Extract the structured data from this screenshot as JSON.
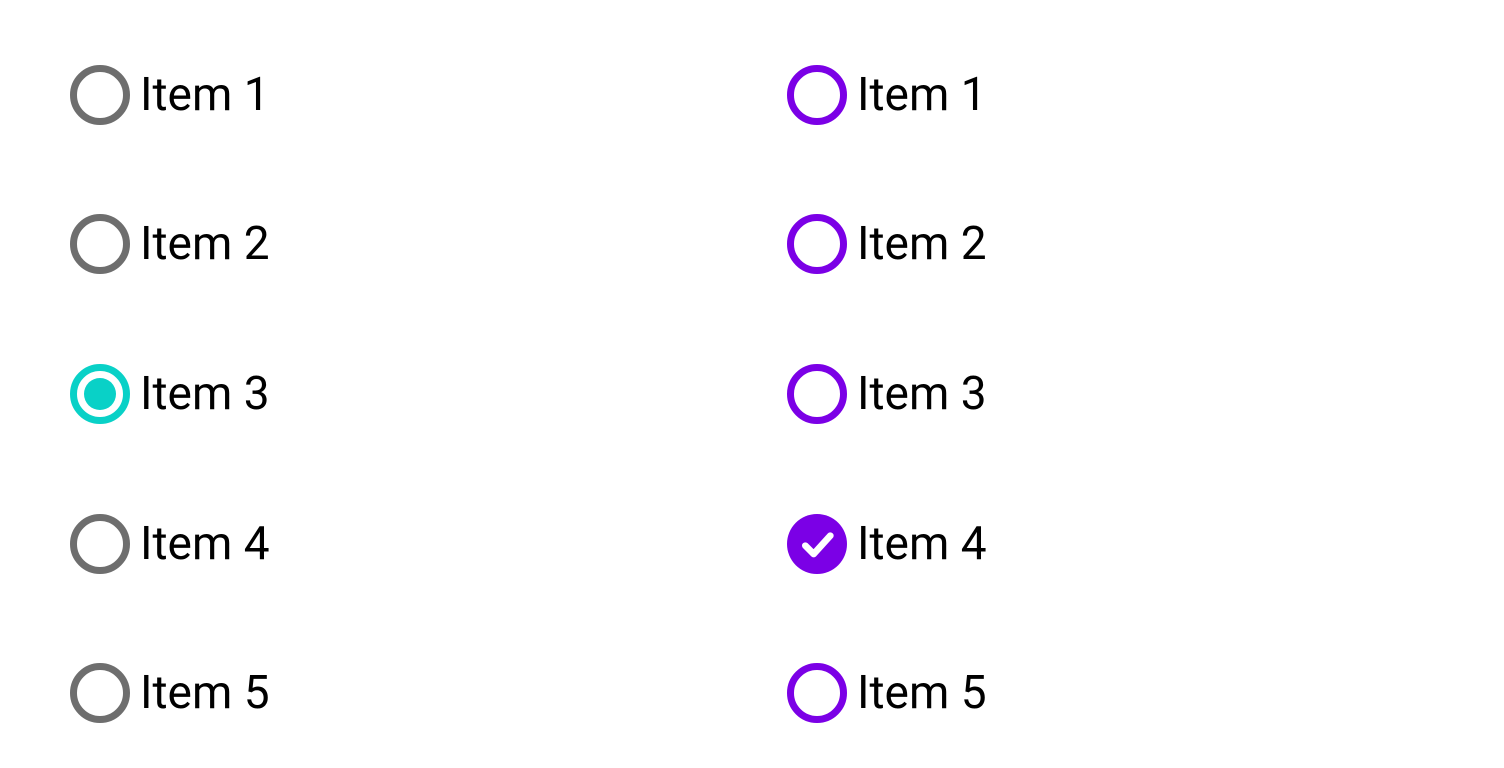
{
  "left": {
    "style": "radio-dot",
    "colors": {
      "unselected": "#6e6e6e",
      "selected": "#09d1c7"
    },
    "selectedIndex": 2,
    "items": [
      {
        "label": "Item 1"
      },
      {
        "label": "Item 2"
      },
      {
        "label": "Item 3"
      },
      {
        "label": "Item 4"
      },
      {
        "label": "Item 5"
      }
    ]
  },
  "right": {
    "style": "radio-check",
    "colors": {
      "unselected": "#7b00e6",
      "selected": "#7b00e6"
    },
    "selectedIndex": 3,
    "items": [
      {
        "label": "Item 1"
      },
      {
        "label": "Item 2"
      },
      {
        "label": "Item 3"
      },
      {
        "label": "Item 4"
      },
      {
        "label": "Item 5"
      }
    ]
  }
}
